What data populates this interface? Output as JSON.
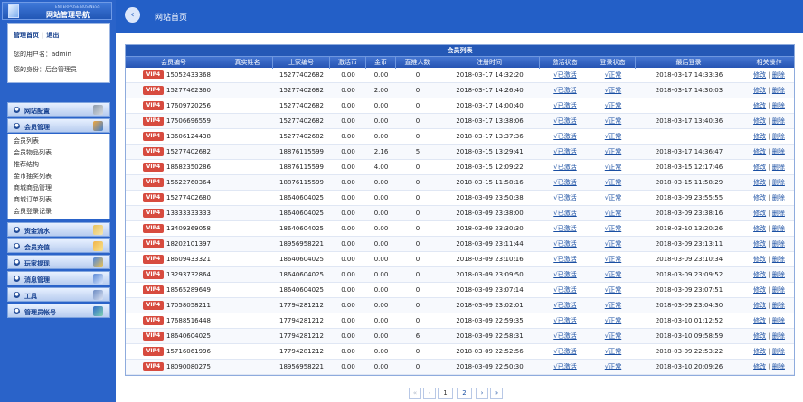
{
  "app": {
    "logo_small_text": "ENTERPRISE BUSINESS",
    "logo_title": "网站管理导航"
  },
  "header": {
    "title": "网站首页"
  },
  "user": {
    "top_links": [
      "管理首页",
      "退出"
    ],
    "username_label": "您的用户名：",
    "username": "admin",
    "role_label": "您的身份：",
    "role": "后台管理员"
  },
  "sidebar": {
    "menus": [
      {
        "label": "网站配置",
        "icon": "tools-icon"
      },
      {
        "label": "会员管理",
        "icon": "members-icon"
      },
      {
        "label": "资金流水",
        "icon": "money-icon"
      },
      {
        "label": "会员充值",
        "icon": "deposit-icon"
      },
      {
        "label": "玩家提现",
        "icon": "withdraw-icon"
      },
      {
        "label": "消息管理",
        "icon": "message-icon"
      },
      {
        "label": "工具",
        "icon": "tool-icon"
      },
      {
        "label": "管理员帐号",
        "icon": "admin-icon"
      }
    ],
    "submenu": [
      "会员列表",
      "会员物品列表",
      "推荐结构",
      "金币抽奖列表",
      "商城商品管理",
      "商城订单列表",
      "会员登录记录"
    ]
  },
  "table": {
    "title": "会员列表",
    "columns": [
      "会员编号",
      "真实姓名",
      "上家编号",
      "激活币",
      "金币",
      "直推人数",
      "注册时间",
      "激活状态",
      "登录状态",
      "最后登录",
      "相关操作"
    ],
    "vip_label": "VIP4",
    "active_label": "√已激活",
    "login_label": "√正常",
    "edit_label": "修改",
    "delete_label": "删除",
    "rows": [
      {
        "member_id": "15052433368",
        "real_name": "",
        "parent_id": "15277402682",
        "activation_coins": "0.00",
        "gold": "0.00",
        "direct_referrals": "0",
        "registered": "2018-03-17 14:32:20",
        "last_login": "2018-03-17 14:33:36"
      },
      {
        "member_id": "15277462360",
        "real_name": "",
        "parent_id": "15277402682",
        "activation_coins": "0.00",
        "gold": "2.00",
        "direct_referrals": "0",
        "registered": "2018-03-17 14:26:40",
        "last_login": "2018-03-17 14:30:03"
      },
      {
        "member_id": "17609720256",
        "real_name": "",
        "parent_id": "15277402682",
        "activation_coins": "0.00",
        "gold": "0.00",
        "direct_referrals": "0",
        "registered": "2018-03-17 14:00:40",
        "last_login": ""
      },
      {
        "member_id": "17506696559",
        "real_name": "",
        "parent_id": "15277402682",
        "activation_coins": "0.00",
        "gold": "0.00",
        "direct_referrals": "0",
        "registered": "2018-03-17 13:38:06",
        "last_login": "2018-03-17 13:40:36"
      },
      {
        "member_id": "13606124438",
        "real_name": "",
        "parent_id": "15277402682",
        "activation_coins": "0.00",
        "gold": "0.00",
        "direct_referrals": "0",
        "registered": "2018-03-17 13:37:36",
        "last_login": ""
      },
      {
        "member_id": "15277402682",
        "real_name": "",
        "parent_id": "18876115599",
        "activation_coins": "0.00",
        "gold": "2.16",
        "direct_referrals": "5",
        "registered": "2018-03-15 13:29:41",
        "last_login": "2018-03-17 14:36:47"
      },
      {
        "member_id": "18682350286",
        "real_name": "",
        "parent_id": "18876115599",
        "activation_coins": "0.00",
        "gold": "4.00",
        "direct_referrals": "0",
        "registered": "2018-03-15 12:09:22",
        "last_login": "2018-03-15 12:17:46"
      },
      {
        "member_id": "15622760364",
        "real_name": "",
        "parent_id": "18876115599",
        "activation_coins": "0.00",
        "gold": "0.00",
        "direct_referrals": "0",
        "registered": "2018-03-15 11:58:16",
        "last_login": "2018-03-15 11:58:29"
      },
      {
        "member_id": "15277402680",
        "real_name": "",
        "parent_id": "18640604025",
        "activation_coins": "0.00",
        "gold": "0.00",
        "direct_referrals": "0",
        "registered": "2018-03-09 23:50:38",
        "last_login": "2018-03-09 23:55:55"
      },
      {
        "member_id": "13333333333",
        "real_name": "",
        "parent_id": "18640604025",
        "activation_coins": "0.00",
        "gold": "0.00",
        "direct_referrals": "0",
        "registered": "2018-03-09 23:38:00",
        "last_login": "2018-03-09 23:38:16"
      },
      {
        "member_id": "13409369058",
        "real_name": "",
        "parent_id": "18640604025",
        "activation_coins": "0.00",
        "gold": "0.00",
        "direct_referrals": "0",
        "registered": "2018-03-09 23:30:30",
        "last_login": "2018-03-10 13:20:26"
      },
      {
        "member_id": "18202101397",
        "real_name": "",
        "parent_id": "18956958221",
        "activation_coins": "0.00",
        "gold": "0.00",
        "direct_referrals": "0",
        "registered": "2018-03-09 23:11:44",
        "last_login": "2018-03-09 23:13:11"
      },
      {
        "member_id": "18609433321",
        "real_name": "",
        "parent_id": "18640604025",
        "activation_coins": "0.00",
        "gold": "0.00",
        "direct_referrals": "0",
        "registered": "2018-03-09 23:10:16",
        "last_login": "2018-03-09 23:10:34"
      },
      {
        "member_id": "13293732864",
        "real_name": "",
        "parent_id": "18640604025",
        "activation_coins": "0.00",
        "gold": "0.00",
        "direct_referrals": "0",
        "registered": "2018-03-09 23:09:50",
        "last_login": "2018-03-09 23:09:52"
      },
      {
        "member_id": "18565289649",
        "real_name": "",
        "parent_id": "18640604025",
        "activation_coins": "0.00",
        "gold": "0.00",
        "direct_referrals": "0",
        "registered": "2018-03-09 23:07:14",
        "last_login": "2018-03-09 23:07:51"
      },
      {
        "member_id": "17058058211",
        "real_name": "",
        "parent_id": "17794281212",
        "activation_coins": "0.00",
        "gold": "0.00",
        "direct_referrals": "0",
        "registered": "2018-03-09 23:02:01",
        "last_login": "2018-03-09 23:04:30"
      },
      {
        "member_id": "17688516448",
        "real_name": "",
        "parent_id": "17794281212",
        "activation_coins": "0.00",
        "gold": "0.00",
        "direct_referrals": "0",
        "registered": "2018-03-09 22:59:35",
        "last_login": "2018-03-10 01:12:52"
      },
      {
        "member_id": "18640604025",
        "real_name": "",
        "parent_id": "17794281212",
        "activation_coins": "0.00",
        "gold": "0.00",
        "direct_referrals": "6",
        "registered": "2018-03-09 22:58:31",
        "last_login": "2018-03-10 09:58:59"
      },
      {
        "member_id": "15716061996",
        "real_name": "",
        "parent_id": "17794281212",
        "activation_coins": "0.00",
        "gold": "0.00",
        "direct_referrals": "0",
        "registered": "2018-03-09 22:52:56",
        "last_login": "2018-03-09 22:53:22"
      },
      {
        "member_id": "18090080275",
        "real_name": "",
        "parent_id": "18956958221",
        "activation_coins": "0.00",
        "gold": "0.00",
        "direct_referrals": "0",
        "registered": "2018-03-09 22:50:30",
        "last_login": "2018-03-10 20:09:26"
      }
    ]
  },
  "pagination": {
    "first": "«",
    "prev": "‹",
    "pages": [
      "1",
      "2"
    ],
    "current_page": "1",
    "next": "›",
    "last": "»"
  }
}
